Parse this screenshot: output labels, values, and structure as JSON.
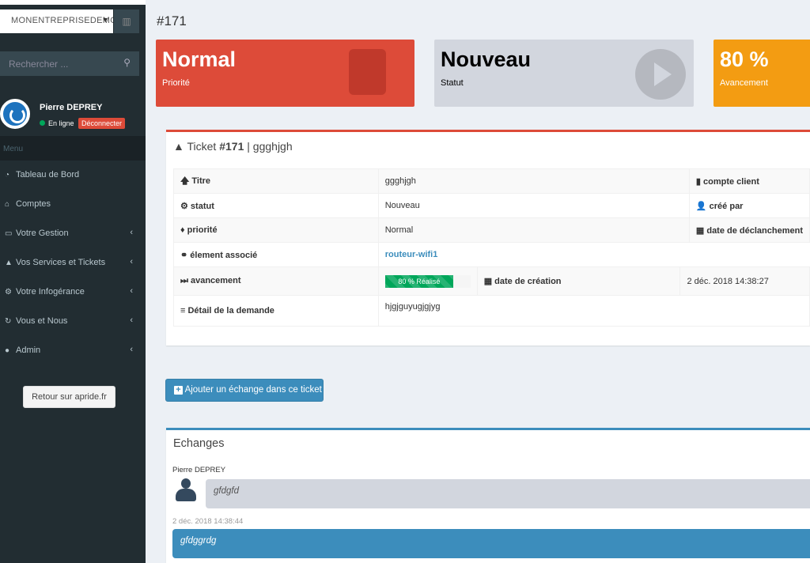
{
  "sidebar": {
    "company_select": "MONENTREPRISEDEMO",
    "search_placeholder": "Rechercher ...",
    "user_name": "Pierre DEPREY",
    "status": "En ligne",
    "logout": "Déconnecter",
    "menu_header": "Menu",
    "items": [
      {
        "label": "Tableau de Bord",
        "icon": "dashboard-icon"
      },
      {
        "label": "Comptes",
        "icon": "home-icon"
      },
      {
        "label": "Votre Gestion",
        "icon": "inbox-icon"
      },
      {
        "label": "Vos Services et Tickets",
        "icon": "warning-icon"
      },
      {
        "label": "Votre Infogérance",
        "icon": "cogs-icon"
      },
      {
        "label": "Vous et Nous",
        "icon": "refresh-icon"
      },
      {
        "label": "Admin",
        "icon": "users-icon"
      }
    ],
    "back_button": "Retour sur apride.fr"
  },
  "page": {
    "title": "#171"
  },
  "info_boxes": [
    {
      "value": "Normal",
      "label": "Priorité",
      "color": "#dd4b39"
    },
    {
      "value": "Nouveau",
      "label": "Statut",
      "color": "#d2d6de"
    },
    {
      "value": "80 %",
      "label": "Avancement",
      "color": "#f39c12"
    }
  ],
  "ticket": {
    "prefix": "Ticket",
    "number": "#171",
    "separator": "|",
    "name": "ggghjgh",
    "rows": {
      "titre_label": "Titre",
      "titre": "ggghjgh",
      "statut_label": "statut",
      "statut": "Nouveau",
      "priorite_label": "priorité",
      "priorite": "Normal",
      "element_label": "élement associé",
      "element": "routeur-wifi1",
      "avancement_label": "avancement",
      "avancement_text": "80 % Réalisé",
      "avancement_pct": 80,
      "creation_label": "date de création",
      "creation": "2 déc. 2018 14:38:27",
      "detail_label": "Détail de la demande",
      "detail": "hjgjguyugjgjyg",
      "compte_label": "compte client",
      "cree_label": "créé par",
      "declenchement_label": "date de déclanchement"
    }
  },
  "add_exchange_button": "Ajouter un échange dans ce ticket",
  "exchanges": {
    "title": "Echanges",
    "messages": [
      {
        "author": "Pierre DEPREY",
        "text": "gfdgfd"
      },
      {
        "date": "2 déc. 2018 14:38:44",
        "text": "gfdggrdg"
      }
    ]
  }
}
